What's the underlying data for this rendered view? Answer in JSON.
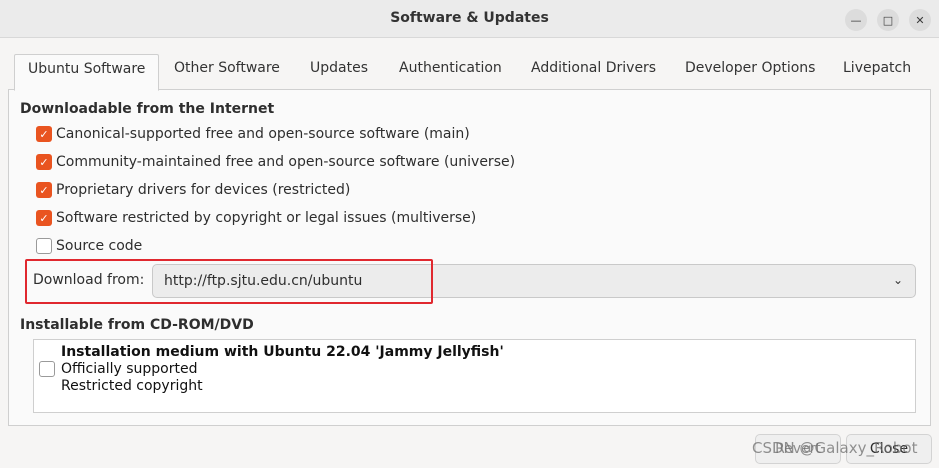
{
  "window": {
    "title": "Software & Updates"
  },
  "tabs": [
    {
      "label": "Ubuntu Software",
      "active": true
    },
    {
      "label": "Other Software"
    },
    {
      "label": "Updates"
    },
    {
      "label": "Authentication"
    },
    {
      "label": "Additional Drivers"
    },
    {
      "label": "Developer Options"
    },
    {
      "label": "Livepatch"
    }
  ],
  "internet": {
    "heading": "Downloadable from the Internet",
    "items": [
      {
        "label": "Canonical-supported free and open-source software (main)",
        "checked": true
      },
      {
        "label": "Community-maintained free and open-source software (universe)",
        "checked": true
      },
      {
        "label": "Proprietary drivers for devices (restricted)",
        "checked": true
      },
      {
        "label": "Software restricted by copyright or legal issues (multiverse)",
        "checked": true
      },
      {
        "label": "Source code",
        "checked": false
      }
    ],
    "download_from_label": "Download from:",
    "download_from_value": "http://ftp.sjtu.edu.cn/ubuntu"
  },
  "cdrom": {
    "heading": "Installable from CD-ROM/DVD",
    "medium_title": "Installation medium with Ubuntu 22.04 'Jammy Jellyfish'",
    "lines": [
      "Officially supported",
      "Restricted copyright"
    ]
  },
  "buttons": {
    "revert": "Revert",
    "close": "Close"
  },
  "watermark": "CSDN @Galaxy_Robot",
  "colors": {
    "accent": "#e95420",
    "highlight": "#e0282f"
  }
}
